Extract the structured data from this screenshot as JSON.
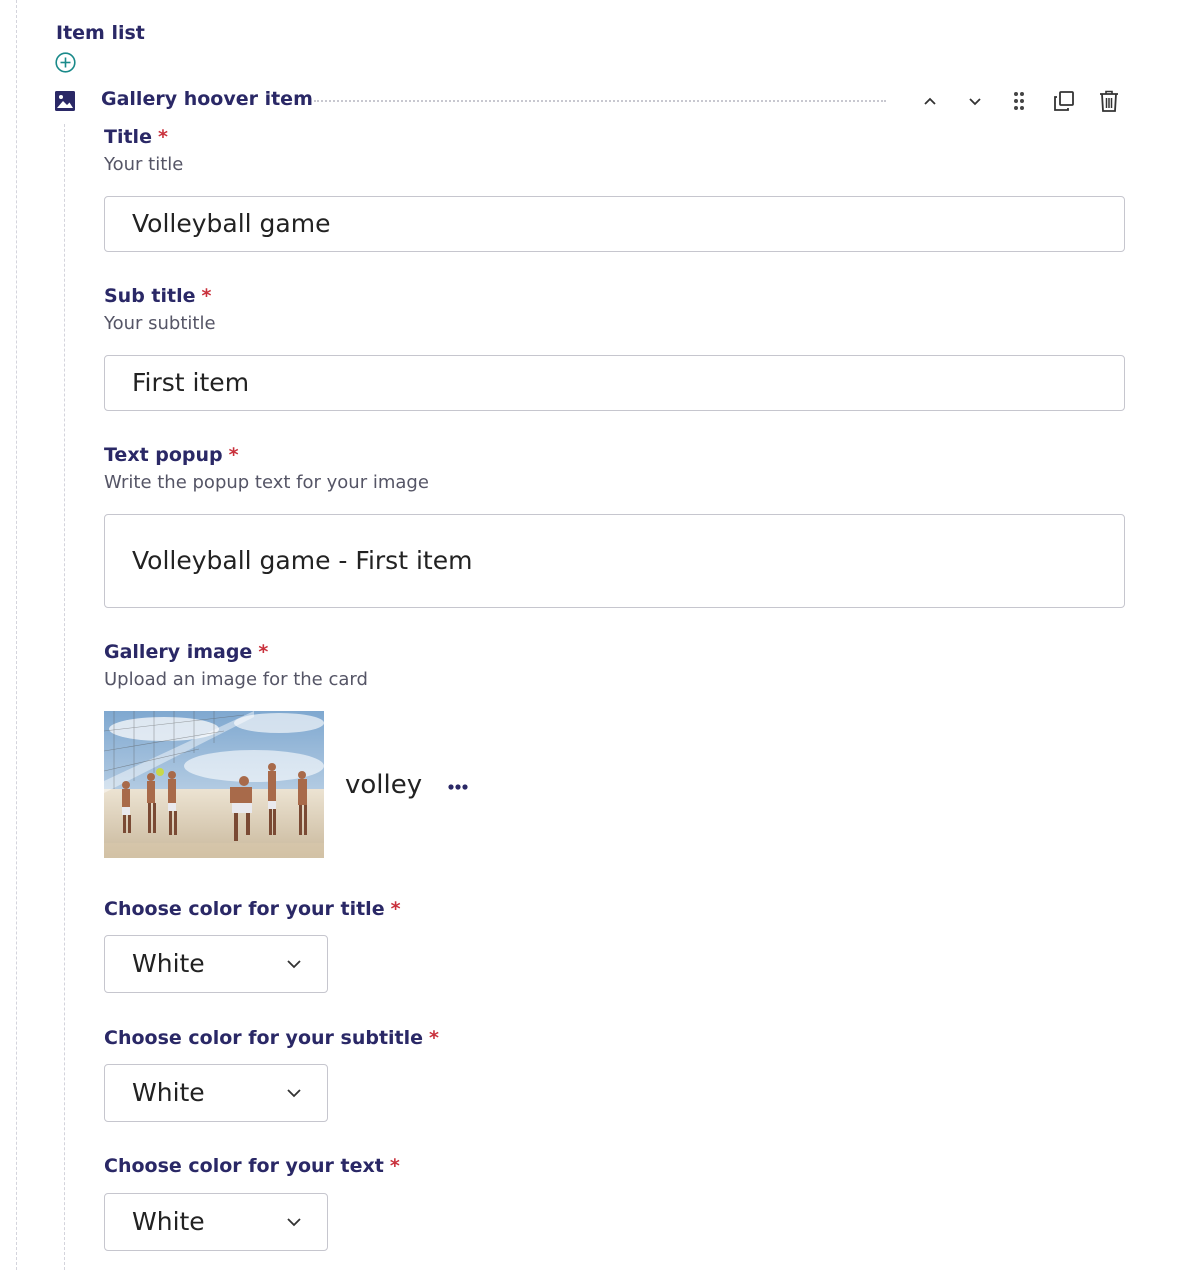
{
  "item_list": {
    "title": "Item list",
    "add_icon": "plus-circle-icon"
  },
  "item": {
    "type_icon": "image-icon",
    "title": "Gallery hoover item",
    "actions": [
      "chevron-up-icon",
      "chevron-down-icon",
      "drag-handle-icon",
      "duplicate-icon",
      "trash-icon"
    ]
  },
  "fields": {
    "required_marker": "*",
    "title": {
      "label": "Title",
      "help": "Your title",
      "value": "Volleyball game"
    },
    "subtitle": {
      "label": "Sub title",
      "help": "Your subtitle",
      "value": "First item"
    },
    "text_popup": {
      "label": "Text popup",
      "help": "Write the popup text for your image",
      "value": "Volleyball game - First item"
    },
    "gallery_image": {
      "label": "Gallery image",
      "help": "Upload an image for the card",
      "file_name": "volley",
      "more_icon": "more-horizontal-icon"
    },
    "title_color": {
      "label": "Choose color for your title",
      "value": "White"
    },
    "subtitle_color": {
      "label": "Choose color for your subtitle",
      "value": "White"
    },
    "text_color": {
      "label": "Choose color for your text",
      "value": "White"
    }
  },
  "colors": {
    "label": "#2a2866",
    "required": "#c9313c",
    "accent_teal": "#1a8a8a",
    "border": "#c6c6ce"
  }
}
